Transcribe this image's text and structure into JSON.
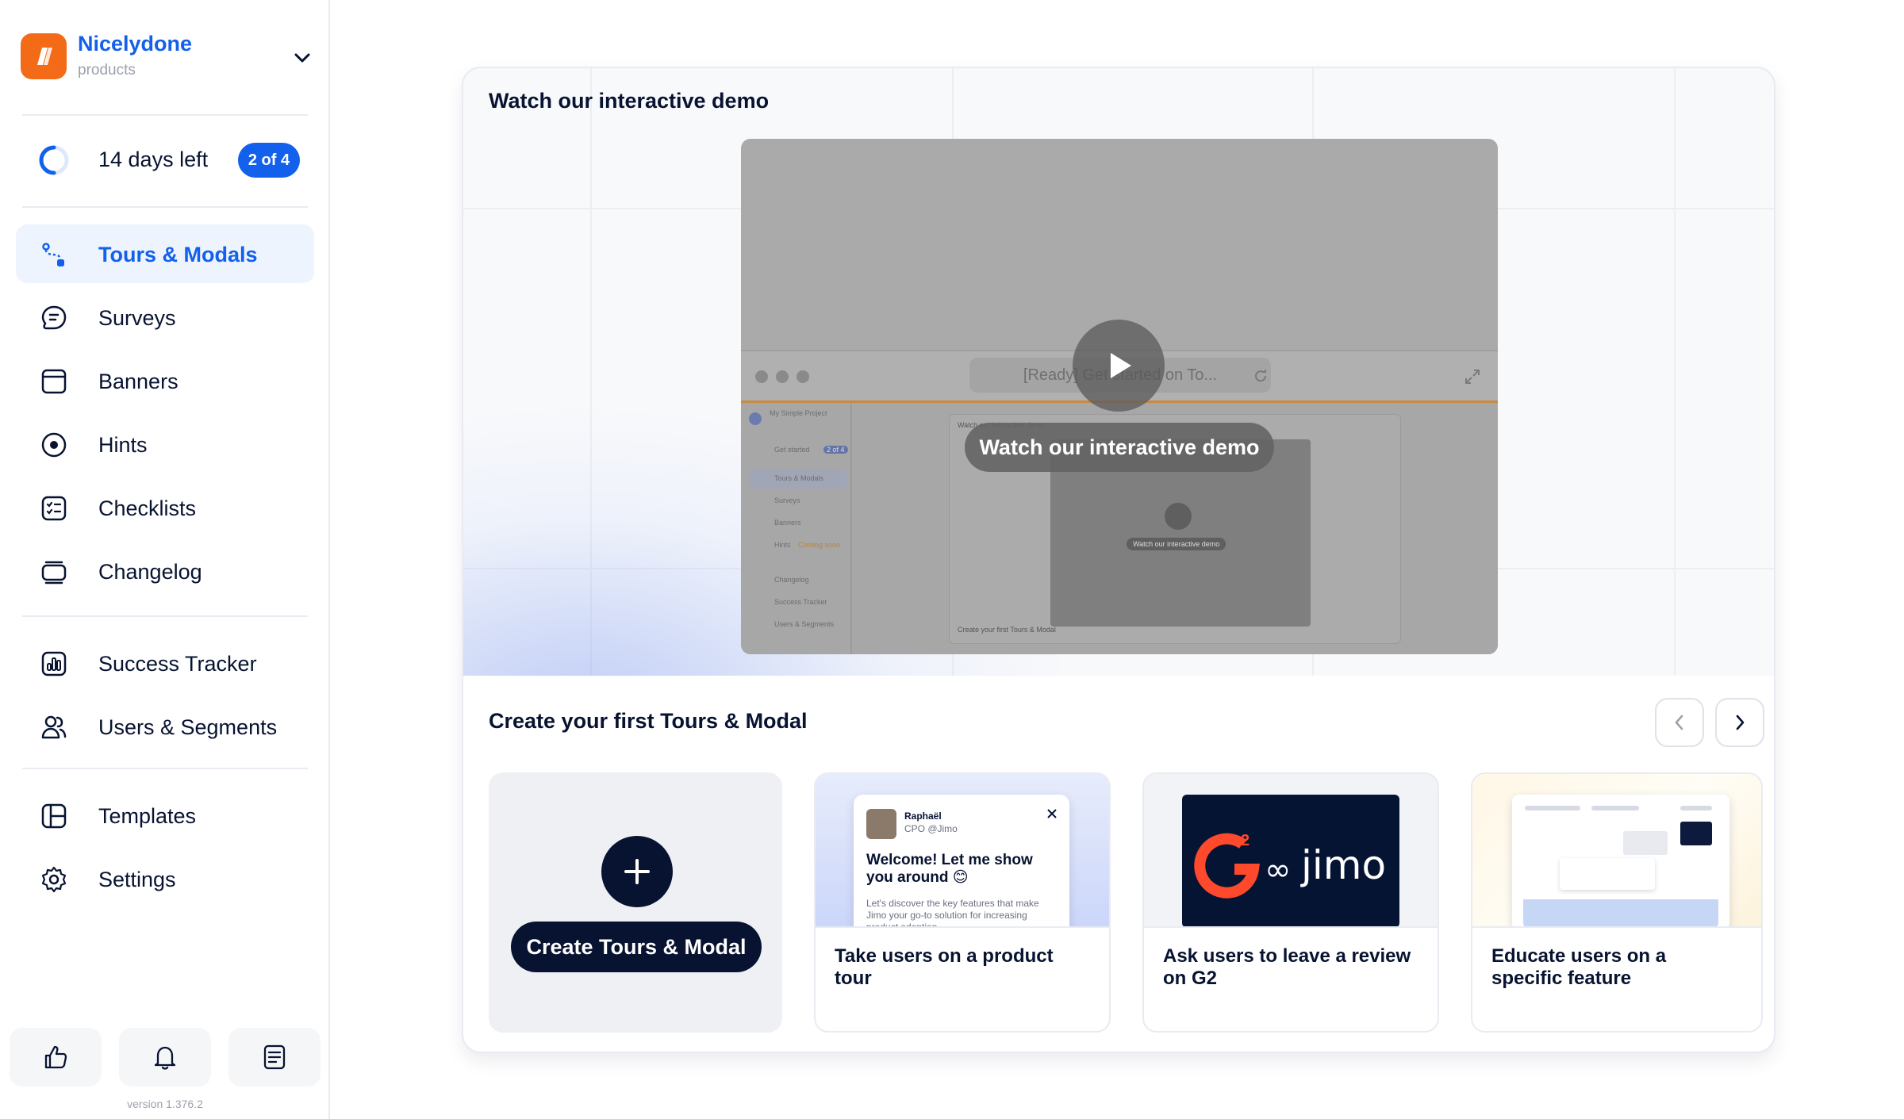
{
  "workspace": {
    "name": "Nicelydone",
    "subtitle": "products"
  },
  "trial": {
    "label": "14 days left",
    "badge": "2 of 4",
    "progress": 0.5
  },
  "nav": {
    "primary": [
      {
        "label": "Tours & Modals",
        "icon": "tours-icon",
        "active": true
      },
      {
        "label": "Surveys",
        "icon": "survey-icon"
      },
      {
        "label": "Banners",
        "icon": "banner-icon"
      },
      {
        "label": "Hints",
        "icon": "hint-icon"
      },
      {
        "label": "Checklists",
        "icon": "checklist-icon"
      },
      {
        "label": "Changelog",
        "icon": "changelog-icon"
      }
    ],
    "secondary": [
      {
        "label": "Success Tracker",
        "icon": "chart-icon"
      },
      {
        "label": "Users & Segments",
        "icon": "users-icon"
      }
    ],
    "tertiary": [
      {
        "label": "Templates",
        "icon": "templates-icon"
      },
      {
        "label": "Settings",
        "icon": "gear-icon"
      }
    ]
  },
  "footer": {
    "version": "version 1.376.2"
  },
  "demo": {
    "title": "Watch our interactive demo",
    "video_url_text": "[Ready] Get started on To...",
    "overlay_label": "Watch our interactive demo",
    "mini": {
      "project": "My Simple Project",
      "get_started": "Get started",
      "badge": "2 of 4",
      "items": [
        "Tours & Modals",
        "Surveys",
        "Banners",
        "Hints",
        "Changelog",
        "Success Tracker",
        "Users & Segments"
      ],
      "hints_tag": "Coming soon",
      "card_title": "Watch our interactive demo",
      "inner_label": "Watch our interactive demo",
      "footer_title": "Create your first Tours & Modal"
    }
  },
  "create_section": {
    "title": "Create your first Tours & Modal",
    "create_button": "Create Tours & Modal",
    "templates": [
      {
        "label": "Take users on a product tour",
        "popup": {
          "author": "Raphaël",
          "role": "CPO @Jimo",
          "heading": "Welcome! Let me show you around 😊",
          "body": "Let's discover the key features that make Jimo your go-to solution for increasing product adoption"
        }
      },
      {
        "label": "Ask users to leave a review on G2",
        "brand": "jimo"
      },
      {
        "label": "Educate users on a specific feature"
      }
    ]
  },
  "colors": {
    "accent": "#1260eb",
    "dark": "#071331",
    "orange": "#f36b17",
    "g2_red": "#ff492c"
  }
}
